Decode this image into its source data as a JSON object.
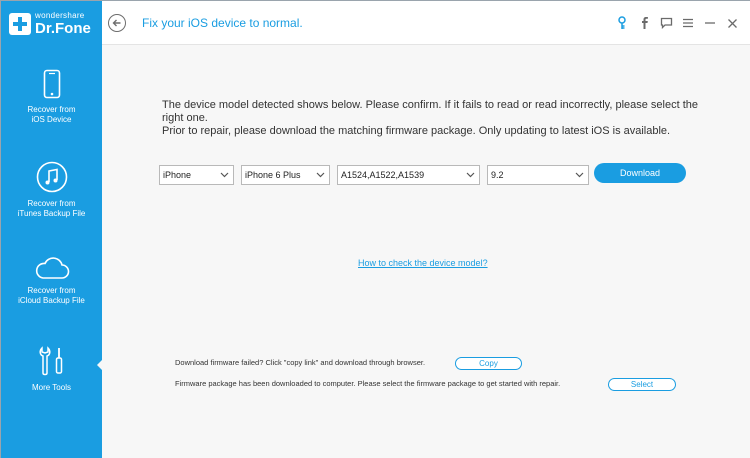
{
  "app": {
    "logo_small": "wondershare",
    "logo_big": "Dr.Fone"
  },
  "sidebar": {
    "items": [
      {
        "label": "Recover from\niOS Device",
        "icon": "phone-icon"
      },
      {
        "label": "Recover from\niTunes Backup File",
        "icon": "music-note-icon"
      },
      {
        "label": "Recover from\niCloud Backup File",
        "icon": "cloud-icon"
      },
      {
        "label": "More Tools",
        "icon": "tools-icon"
      }
    ],
    "active_index": 3
  },
  "header": {
    "title": "Fix your iOS device to normal.",
    "icons": [
      "key-icon",
      "facebook-icon",
      "feedback-icon",
      "menu-icon",
      "minimize-icon",
      "close-icon"
    ]
  },
  "main": {
    "desc_line1": "The device model detected shows below. Please confirm. If it fails to read or read incorrectly, please select the right one.",
    "desc_line2": "Prior to repair, please download the matching firmware package. Only updating to latest iOS is available.",
    "selects": {
      "device": "iPhone",
      "model": "iPhone 6 Plus",
      "model_number": "A1524,A1522,A1539",
      "ios_version": "9.2"
    },
    "download_label": "Download",
    "help_link": "How to check the device model?",
    "footer": {
      "copy_text": "Download firmware failed? Click \"copy link\" and download through browser.",
      "copy_label": "Copy",
      "select_text": "Firmware package has been downloaded to computer. Please select the firmware package to get started with repair.",
      "select_label": "Select"
    }
  },
  "colors": {
    "accent": "#1a9de1",
    "sidebar_bg": "#1a9de1",
    "content_bg": "#f7f7f7"
  }
}
